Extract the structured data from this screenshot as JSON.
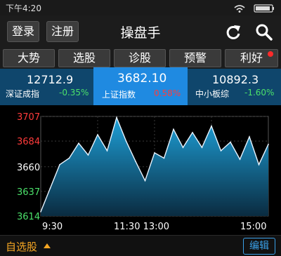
{
  "status_bar": {
    "time": "下午4:20"
  },
  "app_bar": {
    "login_label": "登录",
    "register_label": "注册",
    "title": "操盘手",
    "refresh_icon": "refresh-icon",
    "search_icon": "search-icon"
  },
  "tabs": [
    {
      "label": "大势"
    },
    {
      "label": "选股"
    },
    {
      "label": "诊股"
    },
    {
      "label": "预警"
    },
    {
      "label": "利好",
      "has_badge": true
    }
  ],
  "indices": [
    {
      "name": "深证成指",
      "value": "12712.9",
      "change": "-0.35%",
      "change_color": "#4be06a"
    },
    {
      "name": "上证指数",
      "value": "3682.10",
      "change": "0.58%",
      "change_color": "#ff3b3b",
      "active": true
    },
    {
      "name": "中小板综",
      "value": "10892.3",
      "change": "-1.60%",
      "change_color": "#4be06a"
    }
  ],
  "chart_data": {
    "type": "area",
    "title": "",
    "xlabel": "",
    "ylabel": "",
    "y_ticks": [
      {
        "value": 3707,
        "label": "3707",
        "color": "#ff3b3b"
      },
      {
        "value": 3684,
        "label": "3684",
        "color": "#ff3b3b"
      },
      {
        "value": 3660,
        "label": "3660",
        "color": "#ffffff"
      },
      {
        "value": 3637,
        "label": "3637",
        "color": "#4be06a"
      },
      {
        "value": 3614,
        "label": "3614",
        "color": "#4be06a"
      }
    ],
    "x_ticks": [
      "9:30",
      "11:30 13:00",
      "15:00"
    ],
    "ylim": [
      3614,
      3707
    ],
    "x": [
      0,
      10,
      20,
      30,
      40,
      50,
      60,
      70,
      80,
      90,
      100,
      110,
      120,
      130,
      140,
      150,
      160,
      170,
      180,
      190,
      200,
      210,
      220,
      230,
      240
    ],
    "values": [
      3618,
      3640,
      3662,
      3668,
      3682,
      3671,
      3690,
      3675,
      3706,
      3684,
      3665,
      3647,
      3673,
      3668,
      3695,
      3678,
      3692,
      3678,
      3698,
      3675,
      3683,
      3667,
      3688,
      3662,
      3681
    ],
    "colors": {
      "line": "#e8f4ff",
      "fill_top": "#1ea0d8",
      "fill_bottom": "#0a2b40"
    },
    "grid": true
  },
  "bottom_bar": {
    "watchlist_label": "自选股",
    "edit_label": "编辑"
  }
}
